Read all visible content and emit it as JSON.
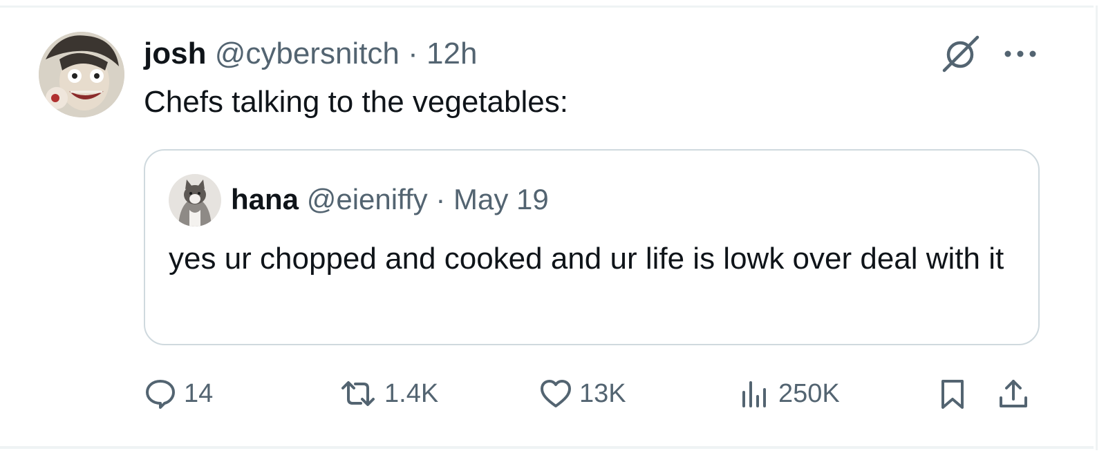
{
  "tweet": {
    "author": {
      "display_name": "josh",
      "handle": "@cybersnitch",
      "avatar": "avatar-image"
    },
    "separator": "·",
    "time": "12h",
    "text": "Chefs talking to the vegetables:",
    "top_icons": [
      "grok-icon",
      "more-options-icon"
    ]
  },
  "quoted_tweet": {
    "author": {
      "display_name": "hana",
      "handle": "@eieniffy",
      "avatar": "cat-avatar-image"
    },
    "separator": "·",
    "date": "May 19",
    "text": "yes ur chopped and cooked and ur life is lowk over deal with it"
  },
  "actions": {
    "replies": "14",
    "reposts": "1.4K",
    "likes": "13K",
    "views": "250K",
    "icons": [
      "reply-icon",
      "repost-icon",
      "like-icon",
      "views-icon",
      "bookmark-icon",
      "share-icon"
    ]
  },
  "colors": {
    "text_primary": "#0f1419",
    "text_secondary": "#536471",
    "border": "#cfd9de",
    "rule": "#eff3f4",
    "background": "#ffffff"
  }
}
